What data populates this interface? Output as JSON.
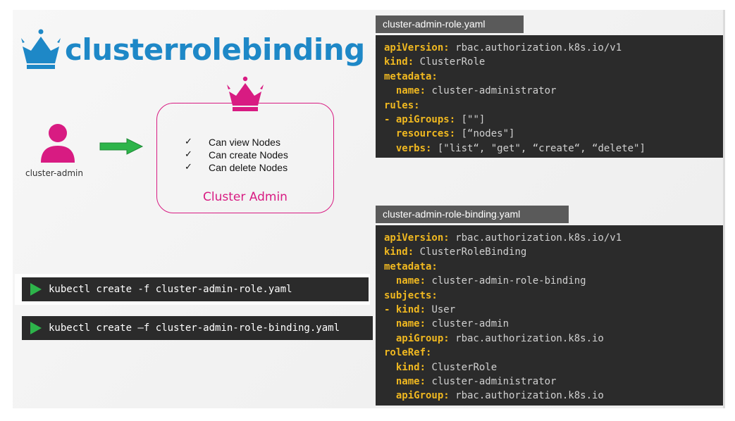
{
  "title": "clusterrolebinding",
  "colors": {
    "accent_blue": "#1e88c7",
    "accent_pink": "#d81b82",
    "arrow_green": "#2db44a",
    "yaml_key": "#f0b820"
  },
  "user": {
    "label": "cluster-admin",
    "icon": "user-icon"
  },
  "role": {
    "name": "Cluster Admin",
    "icon": "crown-icon",
    "permissions": [
      "Can view Nodes",
      "Can create Nodes",
      "Can delete Nodes"
    ]
  },
  "commands": [
    "kubectl create -f cluster-admin-role.yaml",
    "kubectl create –f cluster-admin-role-binding.yaml"
  ],
  "files": [
    {
      "name": "cluster-admin-role.yaml",
      "lines": [
        {
          "indent": "",
          "key": "apiVersion:",
          "value": " rbac.authorization.k8s.io/v1"
        },
        {
          "indent": "",
          "key": "kind:",
          "value": " ClusterRole"
        },
        {
          "indent": "",
          "key": "metadata:",
          "value": ""
        },
        {
          "indent": "  ",
          "key": "name:",
          "value": " cluster-administrator"
        },
        {
          "indent": "",
          "key": "rules:",
          "value": ""
        },
        {
          "indent": "- ",
          "key": "apiGroups:",
          "value": " [\"\"]"
        },
        {
          "indent": "  ",
          "key": "resources:",
          "value": " [“nodes\"]"
        },
        {
          "indent": "  ",
          "key": "verbs:",
          "value": " [\"list“, \"get\", “create“, “delete\"]"
        }
      ]
    },
    {
      "name": "cluster-admin-role-binding.yaml",
      "lines": [
        {
          "indent": "",
          "key": "apiVersion:",
          "value": " rbac.authorization.k8s.io/v1"
        },
        {
          "indent": "",
          "key": "kind:",
          "value": " ClusterRoleBinding"
        },
        {
          "indent": "",
          "key": "metadata:",
          "value": ""
        },
        {
          "indent": "  ",
          "key": "name:",
          "value": " cluster-admin-role-binding"
        },
        {
          "indent": "",
          "key": "subjects:",
          "value": ""
        },
        {
          "indent": "- ",
          "key": "kind:",
          "value": " User"
        },
        {
          "indent": "  ",
          "key": "name:",
          "value": " cluster-admin"
        },
        {
          "indent": "  ",
          "key": "apiGroup:",
          "value": " rbac.authorization.k8s.io"
        },
        {
          "indent": "",
          "key": "roleRef:",
          "value": ""
        },
        {
          "indent": "  ",
          "key": "kind:",
          "value": " ClusterRole"
        },
        {
          "indent": "  ",
          "key": "name:",
          "value": " cluster-administrator"
        },
        {
          "indent": "  ",
          "key": "apiGroup:",
          "value": " rbac.authorization.k8s.io"
        }
      ]
    }
  ]
}
